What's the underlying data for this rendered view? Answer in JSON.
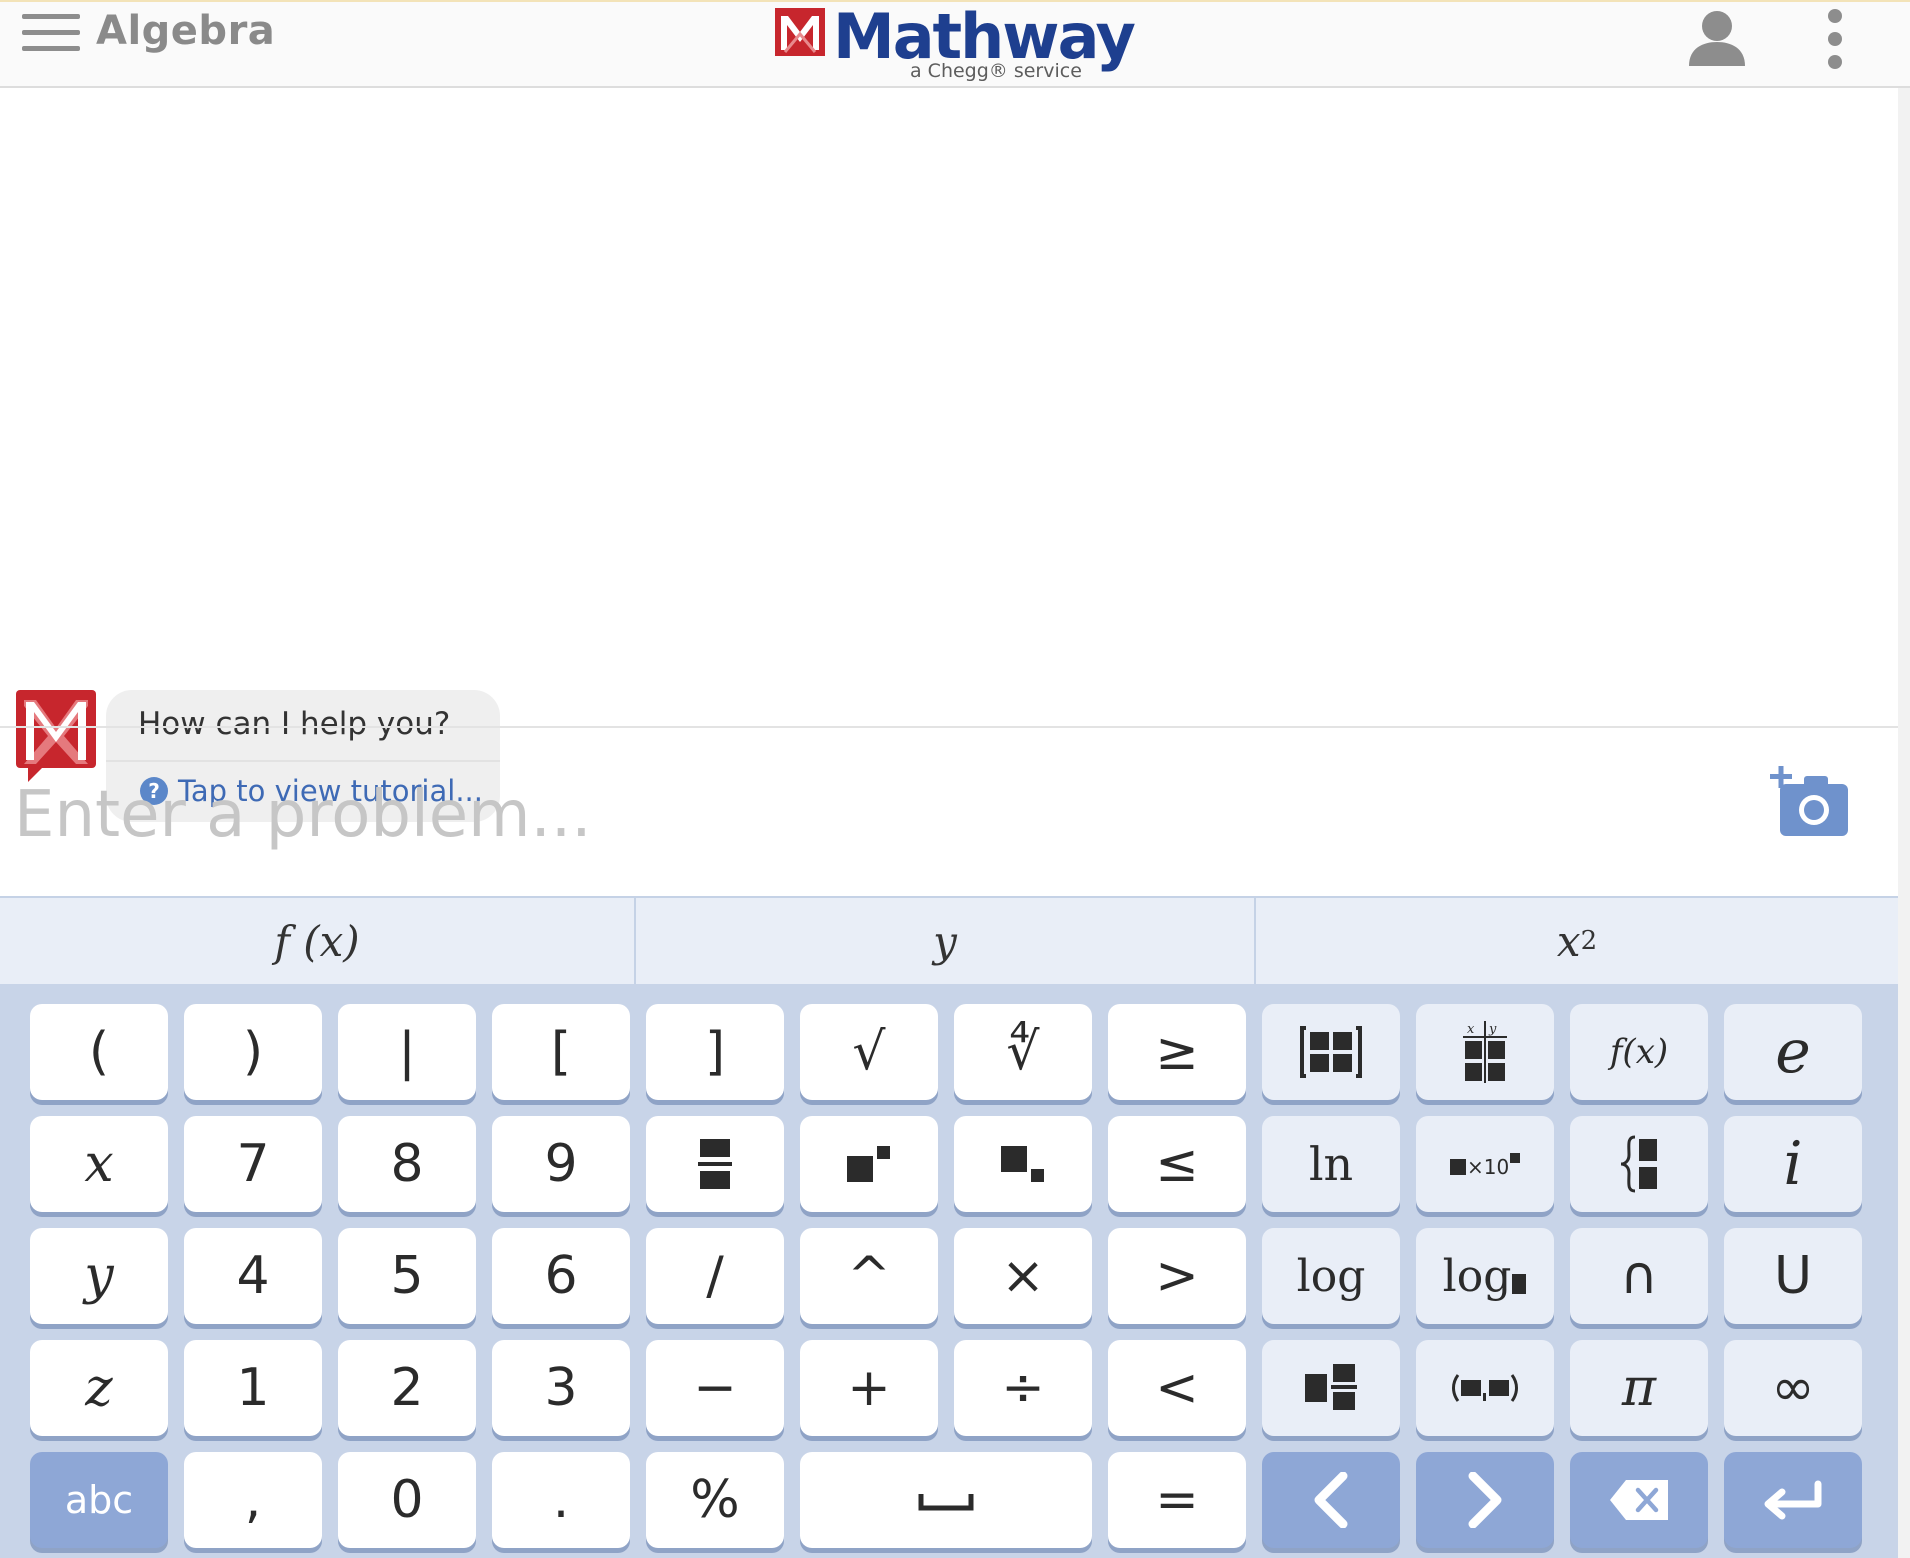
{
  "header": {
    "subject": "Algebra",
    "brand": "Mathway",
    "brand_tagline": "a Chegg® service"
  },
  "chat": {
    "bot_message": "How can I help you?",
    "tutorial_link": "Tap to view tutorial...",
    "help_glyph": "?"
  },
  "input": {
    "placeholder": "Enter a problem..."
  },
  "keyboard": {
    "tabs": [
      {
        "label": "f (x)"
      },
      {
        "label": "y"
      },
      {
        "label": "x",
        "sup": "2"
      }
    ],
    "keys": {
      "open_paren": "(",
      "close_paren": ")",
      "abs_bar": "|",
      "open_bracket": "[",
      "close_bracket": "]",
      "sqrt": "√",
      "nth_root": "∜",
      "geq": "≥",
      "fx": "f(x)",
      "e": "e",
      "x": "x",
      "seven": "7",
      "eight": "8",
      "nine": "9",
      "leq": "≤",
      "ln": "ln",
      "sci_notation": "×10",
      "i": "i",
      "y": "y",
      "four": "4",
      "five": "5",
      "six": "6",
      "slash": "/",
      "caret": "^",
      "times": "×",
      "gt": ">",
      "log": "log",
      "log_base": "log",
      "intersect": "∩",
      "union": "U",
      "z": "z",
      "one": "1",
      "two": "2",
      "three": "3",
      "minus": "−",
      "plus": "+",
      "divide": "÷",
      "lt": "<",
      "pi": "π",
      "infinity": "∞",
      "abc": "abc",
      "comma": ",",
      "zero": "0",
      "dot": ".",
      "percent": "%",
      "space": "␣",
      "equals": "="
    }
  },
  "colors": {
    "brand_blue": "#1e3f8f",
    "brand_red": "#c7262d",
    "keyboard_bg": "#c8d4e8",
    "nav_key": "#8ea7d6",
    "link_blue": "#3e6ab5"
  },
  "icons": [
    "menu-icon",
    "user-icon",
    "more-vertical-icon",
    "camera-add-icon",
    "backspace-icon",
    "enter-icon",
    "arrow-left-icon",
    "arrow-right-icon"
  ]
}
